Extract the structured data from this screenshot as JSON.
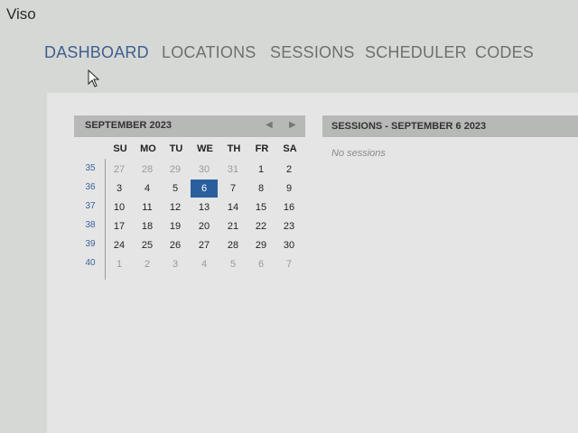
{
  "app": {
    "title": "Viso"
  },
  "nav": {
    "items": [
      {
        "label": "DASHBOARD",
        "active": true
      },
      {
        "label": "LOCATIONS",
        "active": false
      },
      {
        "label": "SESSIONS",
        "active": false
      },
      {
        "label": "SCHEDULER",
        "active": false
      },
      {
        "label": "CODES",
        "active": false
      }
    ]
  },
  "calendar": {
    "title": "SEPTEMBER 2023",
    "prev_icon": "triangle-left",
    "next_icon": "triangle-right",
    "weekdays": [
      "SU",
      "MO",
      "TU",
      "WE",
      "TH",
      "FR",
      "SA"
    ],
    "weeks": [
      {
        "number": "35",
        "days": [
          "27",
          "28",
          "29",
          "30",
          "31",
          "1",
          "2"
        ]
      },
      {
        "number": "36",
        "days": [
          "3",
          "4",
          "5",
          "6",
          "7",
          "8",
          "9"
        ]
      },
      {
        "number": "37",
        "days": [
          "10",
          "11",
          "12",
          "13",
          "14",
          "15",
          "16"
        ]
      },
      {
        "number": "38",
        "days": [
          "17",
          "18",
          "19",
          "20",
          "21",
          "22",
          "23"
        ]
      },
      {
        "number": "39",
        "days": [
          "24",
          "25",
          "26",
          "27",
          "28",
          "29",
          "30"
        ]
      },
      {
        "number": "40",
        "days": [
          "1",
          "2",
          "3",
          "4",
          "5",
          "6",
          "7"
        ]
      }
    ],
    "selected": "6",
    "colors": {
      "selected_bg": "#2a5f9e",
      "week_number": "#3d63a1",
      "outside_month": "#9a9a9a"
    }
  },
  "sessions": {
    "title": "SESSIONS - SEPTEMBER 6 2023",
    "empty_text": "No sessions"
  }
}
